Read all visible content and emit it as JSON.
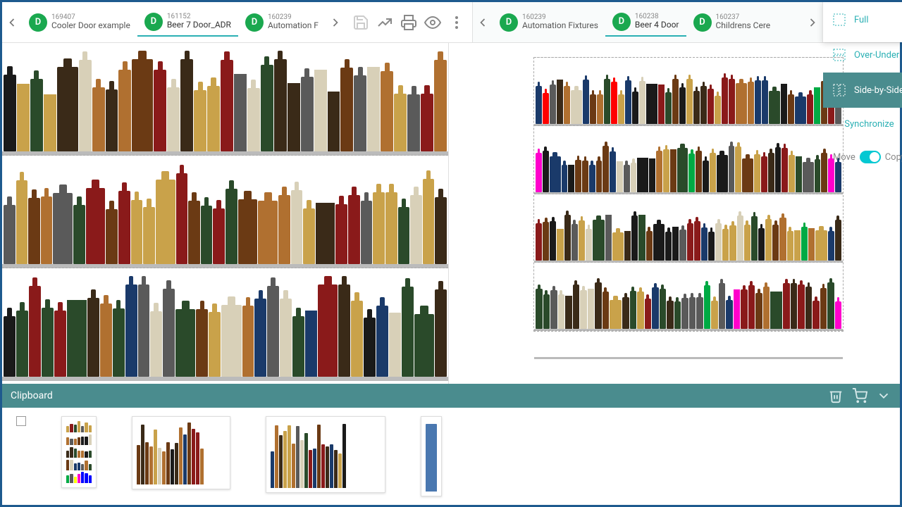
{
  "left_pane": {
    "tabs": [
      {
        "avatar": "D",
        "id": "169407",
        "name": "Cooler Door example",
        "active": false
      },
      {
        "avatar": "D",
        "id": "161152",
        "name": "Beer 7 Door_ADR",
        "active": true
      },
      {
        "avatar": "D",
        "id": "160239",
        "name": "Automation F",
        "active": false
      }
    ]
  },
  "right_pane": {
    "tabs": [
      {
        "avatar": "D",
        "id": "160239",
        "name": "Automation Fixtures",
        "active": false
      },
      {
        "avatar": "D",
        "id": "160238",
        "name": "Beer 4 Door",
        "active": true
      },
      {
        "avatar": "D",
        "id": "160237",
        "name": "Childrens Cere",
        "active": false
      }
    ]
  },
  "toolbar": {
    "save": "save-icon",
    "trend": "trend-icon",
    "print": "print-icon",
    "preview": "preview-icon",
    "more": "more-icon"
  },
  "view_menu": {
    "items": [
      {
        "label": "Full",
        "icon": "full-view-icon",
        "active": false
      },
      {
        "label": "Over-Under",
        "icon": "over-under-icon",
        "active": false
      },
      {
        "label": "Side-by-Side",
        "icon": "side-by-side-icon",
        "active": true
      }
    ],
    "synchronize": "Synchronize",
    "toggle_left": "Move",
    "toggle_right": "Copy",
    "toggle_on": true
  },
  "clipboard": {
    "title": "Clipboard",
    "trash": "trash-icon",
    "cart": "cart-icon",
    "expand": "expand-icon",
    "thumbnails": 4
  },
  "colors": {
    "teal": "#4a8c8e",
    "cyan": "#2bb0b4",
    "green": "#1aa84f",
    "border": "#1e5a8e"
  }
}
